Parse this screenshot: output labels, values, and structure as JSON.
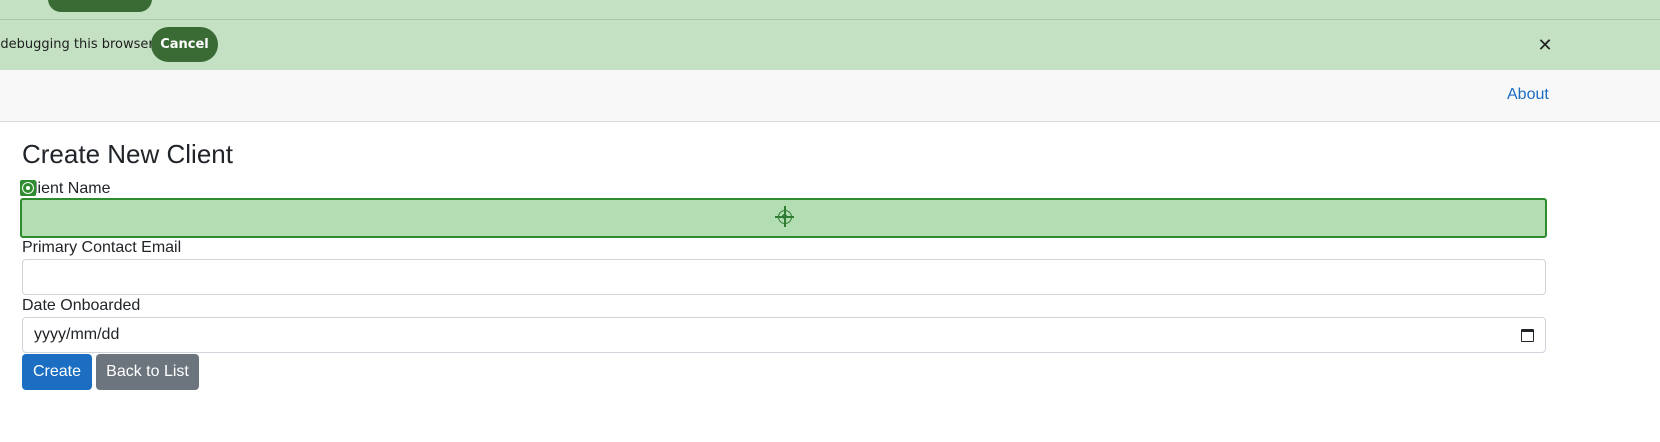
{
  "infobar": {
    "message": "d debugging this browser",
    "cancel_label": "Cancel",
    "close_glyph": "✕",
    "accent_color": "#3a6b35",
    "background_color": "#c4e1c4"
  },
  "navbar": {
    "about_label": "About",
    "link_color": "#1b6ec2"
  },
  "form": {
    "title": "Create New Client",
    "fields": [
      {
        "label": "lient Name",
        "value": "",
        "type": "text",
        "highlighted": true
      },
      {
        "label": "Primary Contact Email",
        "value": "",
        "type": "email"
      },
      {
        "label": "Date Onboarded",
        "placeholder": "yyyy/mm/dd",
        "type": "date"
      }
    ],
    "create_label": "Create",
    "back_label": "Back to List",
    "icons": [
      "target-icon",
      "focus-badge-icon",
      "calendar-icon"
    ]
  }
}
